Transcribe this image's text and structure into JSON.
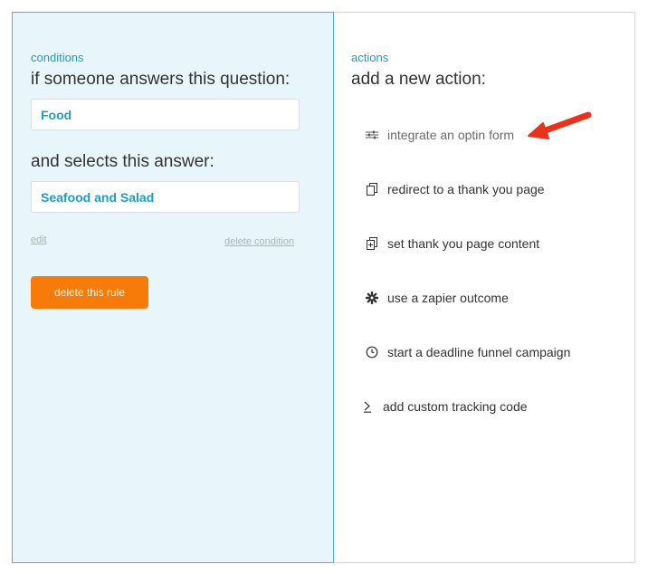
{
  "conditions": {
    "section_label": "conditions",
    "question_heading": "if someone answers this question:",
    "question_value": "Food",
    "answer_heading": "and selects this answer:",
    "answer_value": "Seafood and Salad",
    "edit_link": "edit",
    "delete_condition_link": "delete condition",
    "delete_rule_button": "delete this rule"
  },
  "actions": {
    "section_label": "actions",
    "heading": "add a new action:",
    "items": [
      {
        "label": "integrate an optin form",
        "icon": "sliders-icon"
      },
      {
        "label": "redirect to a thank you page",
        "icon": "pages-icon"
      },
      {
        "label": "set thank you page content",
        "icon": "add-page-icon"
      },
      {
        "label": "use a zapier outcome",
        "icon": "gear-icon"
      },
      {
        "label": "start a deadline funnel campaign",
        "icon": "clock-icon"
      },
      {
        "label": "add custom tracking code",
        "icon": "code-icon"
      }
    ]
  },
  "colors": {
    "accent": "#1f9cc2",
    "button": "#f77b08",
    "panel_bg": "#e8f5fa",
    "annotation_arrow": "#e8321c"
  }
}
